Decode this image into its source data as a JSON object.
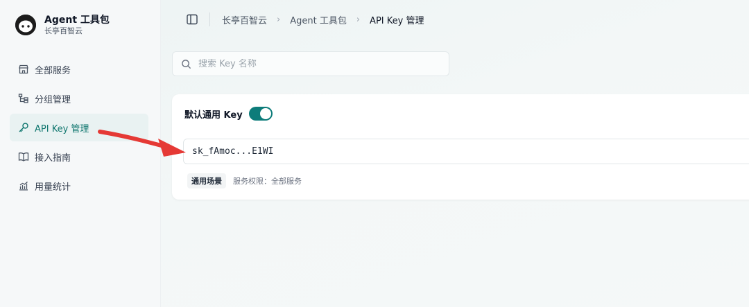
{
  "brand": {
    "title": "Agent 工具包",
    "subtitle": "长亭百智云",
    "logo_icon": "face-logo-icon"
  },
  "sidebar": {
    "items": [
      {
        "label": "全部服务",
        "icon": "store-icon",
        "active": false
      },
      {
        "label": "分组管理",
        "icon": "group-tree-icon",
        "active": false
      },
      {
        "label": "API Key 管理",
        "icon": "key-icon",
        "active": true
      },
      {
        "label": "接入指南",
        "icon": "book-icon",
        "active": false
      },
      {
        "label": "用量统计",
        "icon": "chart-icon",
        "active": false
      }
    ]
  },
  "header": {
    "breadcrumb": [
      "长亭百智云",
      "Agent 工具包",
      "API Key 管理"
    ]
  },
  "search": {
    "placeholder": "搜索 Key 名称",
    "value": ""
  },
  "key_card": {
    "title": "默认通用 Key",
    "enabled": true,
    "key_masked": "sk_fAmoc...E1WI",
    "tag": "通用场景",
    "permission": "服务权限：全部服务"
  },
  "colors": {
    "accent": "#0d7c7a",
    "active_bg": "#e9f2f2",
    "annotation_arrow": "#e53935"
  }
}
